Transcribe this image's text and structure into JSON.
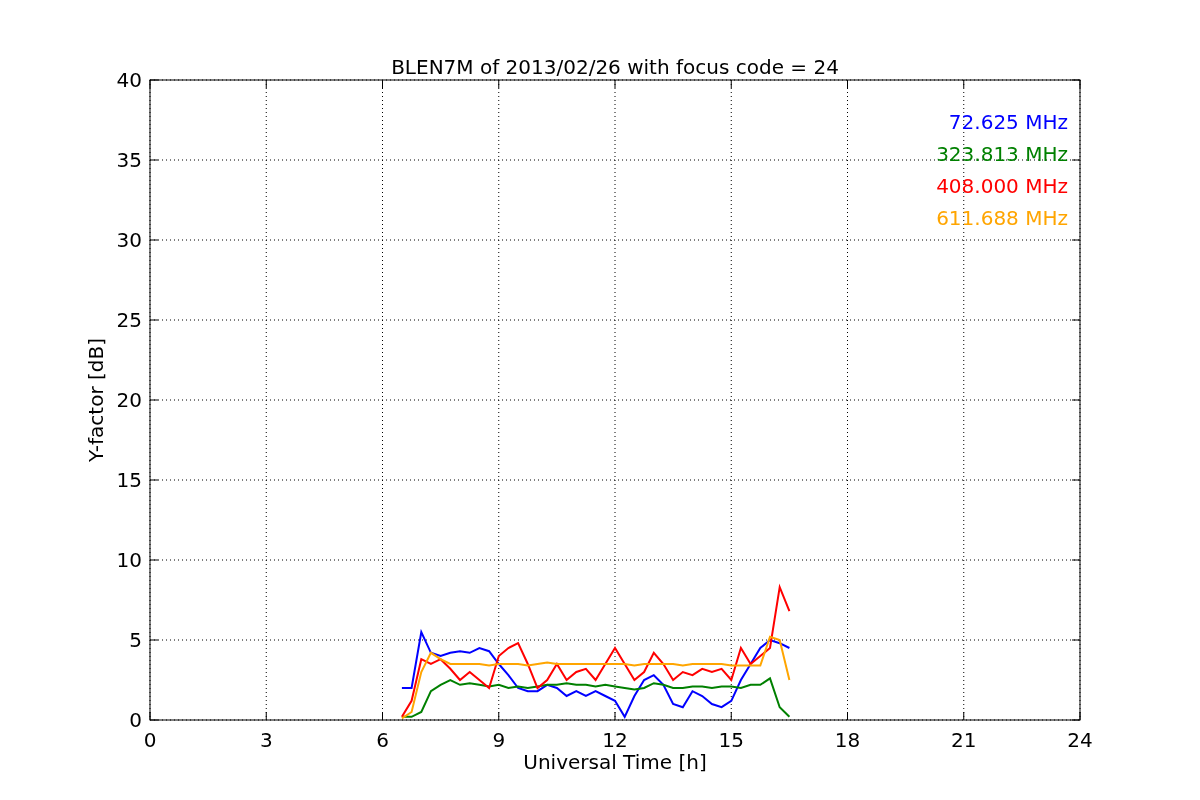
{
  "chart_data": {
    "type": "line",
    "title": "BLEN7M of 2013/02/26 with focus code = 24",
    "xlabel": "Universal Time [h]",
    "ylabel": "Y-factor [dB]",
    "x": [
      6.5,
      6.75,
      7,
      7.25,
      7.5,
      7.75,
      8,
      8.25,
      8.5,
      8.75,
      9,
      9.25,
      9.5,
      9.75,
      10,
      10.25,
      10.5,
      10.75,
      11,
      11.25,
      11.5,
      11.75,
      12,
      12.25,
      12.5,
      12.75,
      13,
      13.25,
      13.5,
      13.75,
      14,
      14.25,
      14.5,
      14.75,
      15,
      15.25,
      15.5,
      15.75,
      16,
      16.25,
      16.5
    ],
    "series": [
      {
        "name": "72.625 MHz",
        "color": "#0000ff",
        "values": [
          2,
          2,
          5.5,
          4.2,
          4,
          4.2,
          4.3,
          4.2,
          4.5,
          4.3,
          3.5,
          2.8,
          2,
          1.8,
          1.8,
          2.2,
          2,
          1.5,
          1.8,
          1.5,
          1.8,
          1.5,
          1.2,
          0.2,
          1.5,
          2.5,
          2.8,
          2.2,
          1,
          0.8,
          1.8,
          1.5,
          1,
          0.8,
          1.2,
          2.5,
          3.5,
          4.5,
          5,
          4.8,
          4.5
        ]
      },
      {
        "name": "323.813 MHz",
        "color": "#008000",
        "values": [
          0.2,
          0.2,
          0.5,
          1.8,
          2.2,
          2.5,
          2.2,
          2.3,
          2.2,
          2.1,
          2.2,
          2,
          2.1,
          2,
          2.1,
          2.2,
          2.2,
          2.3,
          2.2,
          2.2,
          2.1,
          2.2,
          2.1,
          2,
          1.9,
          2,
          2.3,
          2.2,
          2,
          2,
          2.1,
          2.1,
          2,
          2.1,
          2.1,
          2,
          2.2,
          2.2,
          2.6,
          0.8,
          0.2
        ]
      },
      {
        "name": "408.000 MHz",
        "color": "#ff0000",
        "values": [
          0.2,
          1.2,
          3.8,
          3.5,
          3.8,
          3.2,
          2.5,
          3,
          2.5,
          2,
          4,
          4.5,
          4.8,
          3.5,
          2,
          2.5,
          3.5,
          2.5,
          3,
          3.2,
          2.5,
          3.5,
          4.5,
          3.5,
          2.5,
          3,
          4.2,
          3.5,
          2.5,
          3,
          2.8,
          3.2,
          3,
          3.2,
          2.5,
          4.5,
          3.5,
          4,
          4.5,
          8.3,
          6.8
        ]
      },
      {
        "name": "611.688 MHz",
        "color": "#ffa500",
        "values": [
          0.1,
          0.5,
          3,
          4.2,
          3.8,
          3.5,
          3.5,
          3.5,
          3.5,
          3.4,
          3.5,
          3.5,
          3.5,
          3.4,
          3.5,
          3.6,
          3.5,
          3.5,
          3.5,
          3.5,
          3.5,
          3.5,
          3.5,
          3.5,
          3.4,
          3.5,
          3.5,
          3.5,
          3.5,
          3.4,
          3.5,
          3.5,
          3.5,
          3.5,
          3.4,
          3.4,
          3.4,
          3.4,
          5.2,
          5,
          2.5
        ]
      }
    ],
    "xlim": [
      0,
      24
    ],
    "ylim": [
      0,
      40
    ],
    "xticks": [
      0,
      3,
      6,
      9,
      12,
      15,
      18,
      21,
      24
    ],
    "yticks": [
      0,
      5,
      10,
      15,
      20,
      25,
      30,
      35,
      40
    ],
    "grid": true
  }
}
